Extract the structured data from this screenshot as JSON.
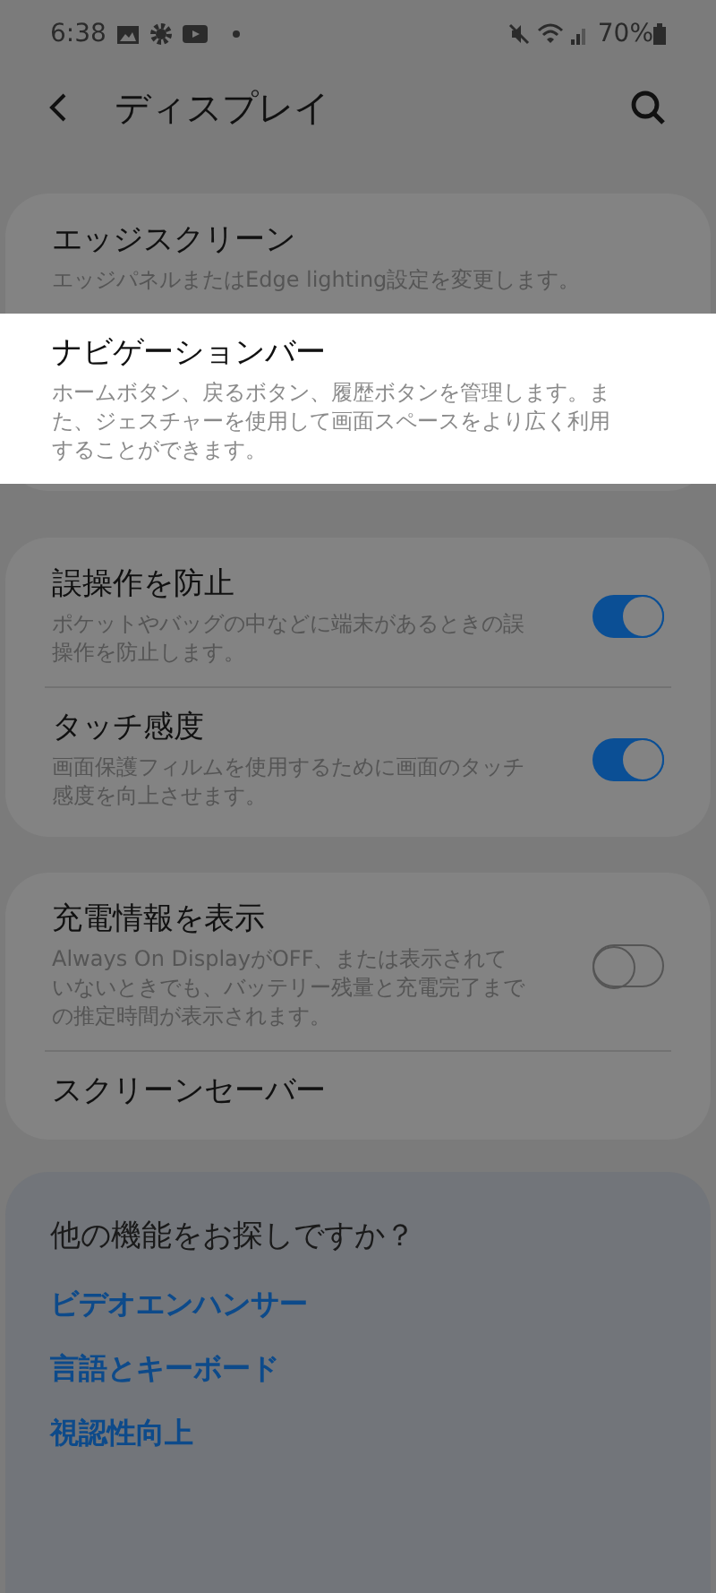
{
  "status_bar": {
    "time": "6:38",
    "battery": "70%"
  },
  "header": {
    "title": "ディスプレイ"
  },
  "groups": [
    {
      "items": [
        {
          "kind": "text",
          "title": "エッジスクリーン",
          "description": "エッジパネルまたはEdge lighting設定を変更します。",
          "highlighted": false
        },
        {
          "kind": "text",
          "title": "ナビゲーションバー",
          "description": "ホームボタン、戻るボタン、履歴ボタンを管理します。また、ジェスチャーを使用して画面スペースをより広く利用することができます。",
          "highlighted": true
        }
      ]
    },
    {
      "items": [
        {
          "kind": "toggle",
          "title": "誤操作を防止",
          "description": "ポケットやバッグの中などに端末があるときの誤操作を防止します。",
          "on": true
        },
        {
          "kind": "toggle",
          "title": "タッチ感度",
          "description": "画面保護フィルムを使用するために画面のタッチ感度を向上させます。",
          "on": true
        }
      ]
    },
    {
      "items": [
        {
          "kind": "toggle",
          "title": "充電情報を表示",
          "description": "Always On DisplayがOFF、または表示されていないときでも、バッテリー残量と充電完了までの推定時間が表示されます。",
          "on": false
        },
        {
          "kind": "text",
          "title": "スクリーンセーバー",
          "highlighted": false
        }
      ]
    }
  ],
  "suggestions": {
    "title": "他の機能をお探しですか？",
    "links": [
      "ビデオエンハンサー",
      "言語とキーボード",
      "視認性向上"
    ]
  }
}
